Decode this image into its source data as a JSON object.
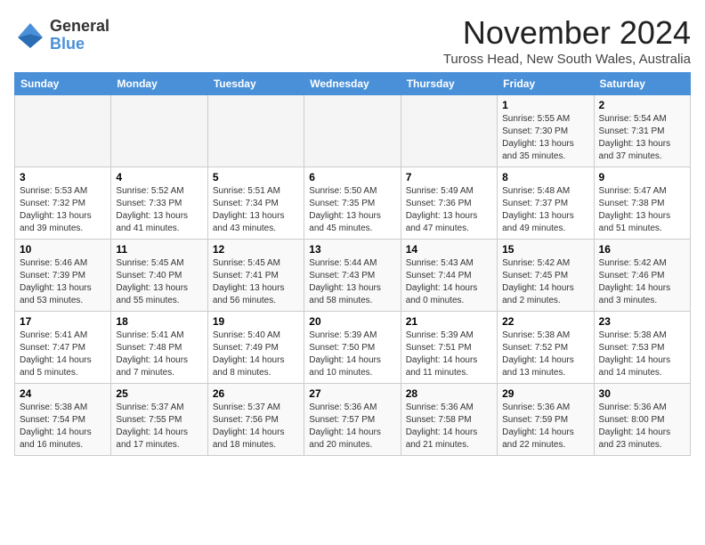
{
  "header": {
    "logo_general": "General",
    "logo_blue": "Blue",
    "month_title": "November 2024",
    "location": "Tuross Head, New South Wales, Australia"
  },
  "weekdays": [
    "Sunday",
    "Monday",
    "Tuesday",
    "Wednesday",
    "Thursday",
    "Friday",
    "Saturday"
  ],
  "weeks": [
    [
      {
        "day": "",
        "info": ""
      },
      {
        "day": "",
        "info": ""
      },
      {
        "day": "",
        "info": ""
      },
      {
        "day": "",
        "info": ""
      },
      {
        "day": "",
        "info": ""
      },
      {
        "day": "1",
        "info": "Sunrise: 5:55 AM\nSunset: 7:30 PM\nDaylight: 13 hours\nand 35 minutes."
      },
      {
        "day": "2",
        "info": "Sunrise: 5:54 AM\nSunset: 7:31 PM\nDaylight: 13 hours\nand 37 minutes."
      }
    ],
    [
      {
        "day": "3",
        "info": "Sunrise: 5:53 AM\nSunset: 7:32 PM\nDaylight: 13 hours\nand 39 minutes."
      },
      {
        "day": "4",
        "info": "Sunrise: 5:52 AM\nSunset: 7:33 PM\nDaylight: 13 hours\nand 41 minutes."
      },
      {
        "day": "5",
        "info": "Sunrise: 5:51 AM\nSunset: 7:34 PM\nDaylight: 13 hours\nand 43 minutes."
      },
      {
        "day": "6",
        "info": "Sunrise: 5:50 AM\nSunset: 7:35 PM\nDaylight: 13 hours\nand 45 minutes."
      },
      {
        "day": "7",
        "info": "Sunrise: 5:49 AM\nSunset: 7:36 PM\nDaylight: 13 hours\nand 47 minutes."
      },
      {
        "day": "8",
        "info": "Sunrise: 5:48 AM\nSunset: 7:37 PM\nDaylight: 13 hours\nand 49 minutes."
      },
      {
        "day": "9",
        "info": "Sunrise: 5:47 AM\nSunset: 7:38 PM\nDaylight: 13 hours\nand 51 minutes."
      }
    ],
    [
      {
        "day": "10",
        "info": "Sunrise: 5:46 AM\nSunset: 7:39 PM\nDaylight: 13 hours\nand 53 minutes."
      },
      {
        "day": "11",
        "info": "Sunrise: 5:45 AM\nSunset: 7:40 PM\nDaylight: 13 hours\nand 55 minutes."
      },
      {
        "day": "12",
        "info": "Sunrise: 5:45 AM\nSunset: 7:41 PM\nDaylight: 13 hours\nand 56 minutes."
      },
      {
        "day": "13",
        "info": "Sunrise: 5:44 AM\nSunset: 7:43 PM\nDaylight: 13 hours\nand 58 minutes."
      },
      {
        "day": "14",
        "info": "Sunrise: 5:43 AM\nSunset: 7:44 PM\nDaylight: 14 hours\nand 0 minutes."
      },
      {
        "day": "15",
        "info": "Sunrise: 5:42 AM\nSunset: 7:45 PM\nDaylight: 14 hours\nand 2 minutes."
      },
      {
        "day": "16",
        "info": "Sunrise: 5:42 AM\nSunset: 7:46 PM\nDaylight: 14 hours\nand 3 minutes."
      }
    ],
    [
      {
        "day": "17",
        "info": "Sunrise: 5:41 AM\nSunset: 7:47 PM\nDaylight: 14 hours\nand 5 minutes."
      },
      {
        "day": "18",
        "info": "Sunrise: 5:41 AM\nSunset: 7:48 PM\nDaylight: 14 hours\nand 7 minutes."
      },
      {
        "day": "19",
        "info": "Sunrise: 5:40 AM\nSunset: 7:49 PM\nDaylight: 14 hours\nand 8 minutes."
      },
      {
        "day": "20",
        "info": "Sunrise: 5:39 AM\nSunset: 7:50 PM\nDaylight: 14 hours\nand 10 minutes."
      },
      {
        "day": "21",
        "info": "Sunrise: 5:39 AM\nSunset: 7:51 PM\nDaylight: 14 hours\nand 11 minutes."
      },
      {
        "day": "22",
        "info": "Sunrise: 5:38 AM\nSunset: 7:52 PM\nDaylight: 14 hours\nand 13 minutes."
      },
      {
        "day": "23",
        "info": "Sunrise: 5:38 AM\nSunset: 7:53 PM\nDaylight: 14 hours\nand 14 minutes."
      }
    ],
    [
      {
        "day": "24",
        "info": "Sunrise: 5:38 AM\nSunset: 7:54 PM\nDaylight: 14 hours\nand 16 minutes."
      },
      {
        "day": "25",
        "info": "Sunrise: 5:37 AM\nSunset: 7:55 PM\nDaylight: 14 hours\nand 17 minutes."
      },
      {
        "day": "26",
        "info": "Sunrise: 5:37 AM\nSunset: 7:56 PM\nDaylight: 14 hours\nand 18 minutes."
      },
      {
        "day": "27",
        "info": "Sunrise: 5:36 AM\nSunset: 7:57 PM\nDaylight: 14 hours\nand 20 minutes."
      },
      {
        "day": "28",
        "info": "Sunrise: 5:36 AM\nSunset: 7:58 PM\nDaylight: 14 hours\nand 21 minutes."
      },
      {
        "day": "29",
        "info": "Sunrise: 5:36 AM\nSunset: 7:59 PM\nDaylight: 14 hours\nand 22 minutes."
      },
      {
        "day": "30",
        "info": "Sunrise: 5:36 AM\nSunset: 8:00 PM\nDaylight: 14 hours\nand 23 minutes."
      }
    ]
  ]
}
